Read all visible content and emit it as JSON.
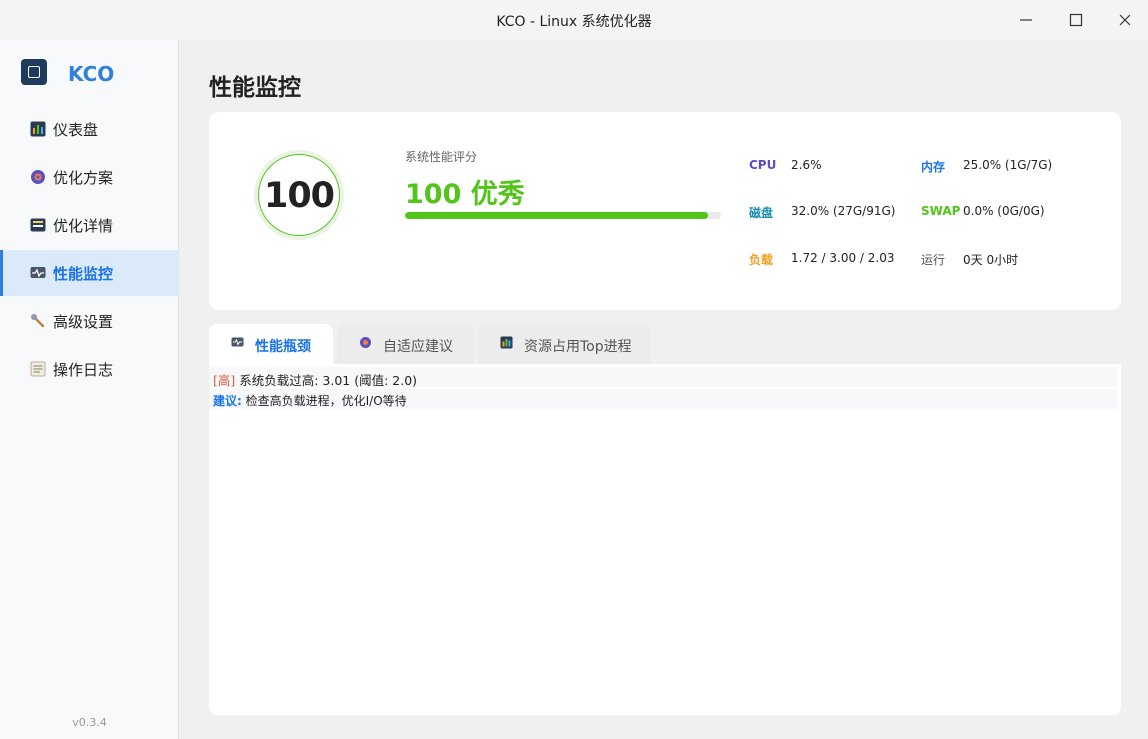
{
  "window": {
    "title": "KCO - Linux 系统优化器"
  },
  "sidebar": {
    "logo_text": "KCO",
    "items": [
      {
        "label": "仪表盘",
        "icon": "bar-chart-icon"
      },
      {
        "label": "优化方案",
        "icon": "target-icon"
      },
      {
        "label": "优化详情",
        "icon": "card-icon"
      },
      {
        "label": "性能监控",
        "icon": "monitor-icon",
        "active": true
      },
      {
        "label": "高级设置",
        "icon": "wrench-icon"
      },
      {
        "label": "操作日志",
        "icon": "log-icon"
      }
    ],
    "version": "v0.3.4"
  },
  "main": {
    "title": "性能监控",
    "score": {
      "number": "100",
      "label": "系统性能评分",
      "value_text": "100  优秀",
      "progress_percent": 96
    },
    "stats": {
      "cpu": {
        "key": "CPU",
        "value": "2.6%"
      },
      "mem": {
        "key": "内存",
        "value": "25.0%  (1G/7G)"
      },
      "disk": {
        "key": "磁盘",
        "value": "32.0%  (27G/91G)"
      },
      "swap": {
        "key": "SWAP",
        "value": "0.0%  (0G/0G)"
      },
      "load": {
        "key": "负载",
        "value": "1.72  /  3.00  /  2.03"
      },
      "uptime": {
        "key": "运行",
        "value": "0天 0小时"
      }
    },
    "tabs": [
      {
        "label": "性能瓶颈",
        "active": true
      },
      {
        "label": "自适应建议"
      },
      {
        "label": "资源占用Top进程"
      }
    ],
    "bottleneck": {
      "tag": "[高]",
      "text": " 系统负载过高: 3.01 (阈值: 2.0)",
      "suggest_label": "建议:",
      "suggest_text": "  检查高负载进程，优化I/O等待"
    }
  },
  "colors": {
    "accent": "#1a73e8",
    "success": "#52c41a",
    "cpu": "#5b4fc4",
    "mem": "#1a73e8",
    "disk": "#1a8fb0",
    "swap": "#52c41a",
    "load": "#f0a020",
    "high": "#e05a3a"
  }
}
